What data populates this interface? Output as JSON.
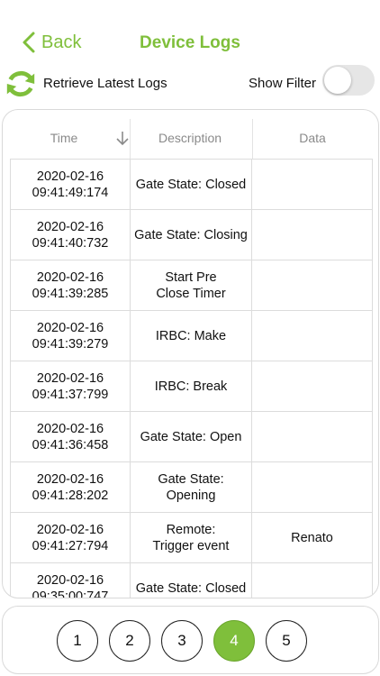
{
  "nav": {
    "back_label": "Back",
    "title": "Device Logs"
  },
  "actions": {
    "retrieve_label": "Retrieve Latest Logs",
    "filter_label": "Show Filter"
  },
  "table": {
    "headers": {
      "time": "Time",
      "description": "Description",
      "data": "Data"
    },
    "rows": [
      {
        "time": "2020-02-16\n09:41:49:174",
        "description": "Gate State: Closed",
        "data": ""
      },
      {
        "time": "2020-02-16\n09:41:40:732",
        "description": "Gate State: Closing",
        "data": ""
      },
      {
        "time": "2020-02-16\n09:41:39:285",
        "description": "Start Pre\nClose Timer",
        "data": ""
      },
      {
        "time": "2020-02-16\n09:41:39:279",
        "description": "IRBC: Make",
        "data": ""
      },
      {
        "time": "2020-02-16\n09:41:37:799",
        "description": "IRBC: Break",
        "data": ""
      },
      {
        "time": "2020-02-16\n09:41:36:458",
        "description": "Gate State: Open",
        "data": ""
      },
      {
        "time": "2020-02-16\n09:41:28:202",
        "description": "Gate State:\nOpening",
        "data": ""
      },
      {
        "time": "2020-02-16\n09:41:27:794",
        "description": "Remote:\nTrigger event",
        "data": "Renato"
      },
      {
        "time": "2020-02-16\n09:35:00:747",
        "description": "Gate State: Closed",
        "data": ""
      }
    ]
  },
  "pager": {
    "pages": [
      "1",
      "2",
      "3",
      "4",
      "5"
    ],
    "active": "4"
  },
  "colors": {
    "accent": "#7fbf3b"
  }
}
